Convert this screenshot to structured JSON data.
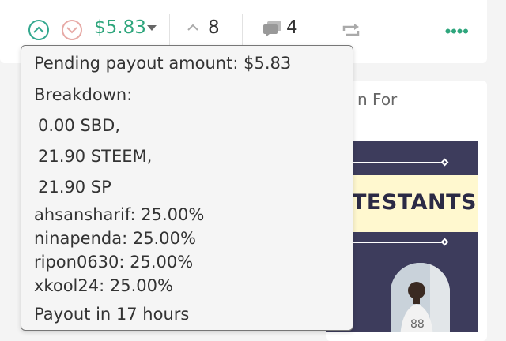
{
  "post": {
    "payout_value": "$5.83",
    "votes_count": "8",
    "comments_count": "4"
  },
  "icons": {
    "upvote": "chevron-up-circle-icon",
    "downvote": "chevron-down-circle-icon",
    "payout_dropdown": "caret-down-icon",
    "votes": "chevron-up-icon",
    "comments": "speech-bubbles-icon",
    "reblog": "reblog-icon",
    "more": "more-dots-icon"
  },
  "colors": {
    "payout_green": "#2fa67d",
    "upvote_border": "#34a88f",
    "downvote_border": "#e7aaa6",
    "more_dots": "#2fa67d",
    "banner_bg": "#3d3c5c",
    "banner_band": "#fff8cf"
  },
  "tooltip": {
    "pending_payout": "Pending payout amount: $5.83",
    "breakdown_label": "Breakdown:",
    "breakdown": [
      "0.00 SBD,",
      "21.90 STEEM,",
      "21.90 SP"
    ],
    "beneficiaries": [
      "ahsansharif: 25.00%",
      "ninapenda: 25.00%",
      "ripon0630: 25.00%",
      "xkool24: 25.00%"
    ],
    "payout_time": "Payout in 17 hours"
  },
  "side_card": {
    "title_fragment": "n For",
    "banner_text": "NTESTANTS"
  }
}
